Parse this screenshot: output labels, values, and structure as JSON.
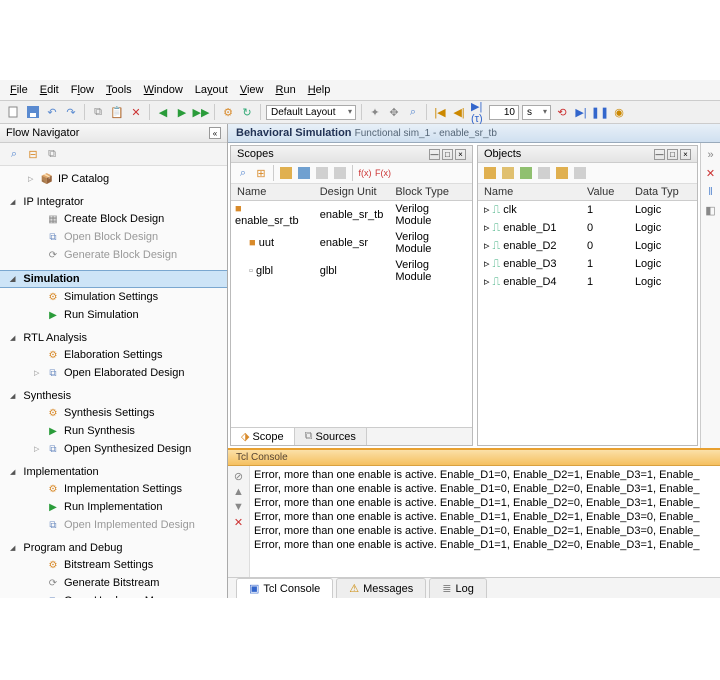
{
  "menu": [
    "File",
    "Edit",
    "Flow",
    "Tools",
    "Window",
    "Layout",
    "View",
    "Run",
    "Help"
  ],
  "toolbar": {
    "layout_combo": "Default Layout",
    "time_value": "10",
    "time_unit": "s"
  },
  "nav": {
    "title": "Flow Navigator",
    "items_top": [
      {
        "label": "Create Block Design",
        "icon": "block"
      },
      {
        "label": "Open Block Design",
        "icon": "open",
        "dim": true
      },
      {
        "label": "Generate Block Design",
        "icon": "gen",
        "dim": true
      }
    ],
    "ip_catalog": "IP Catalog",
    "ip_integrator": "IP Integrator",
    "sim_group": "Simulation",
    "sim_items": [
      {
        "label": "Simulation Settings",
        "icon": "gear"
      },
      {
        "label": "Run Simulation",
        "icon": "run"
      }
    ],
    "rtl_group": "RTL Analysis",
    "rtl_items": [
      {
        "label": "Elaboration Settings",
        "icon": "gear"
      },
      {
        "label": "Open Elaborated Design",
        "icon": "open",
        "expand": true
      }
    ],
    "syn_group": "Synthesis",
    "syn_items": [
      {
        "label": "Synthesis Settings",
        "icon": "gear"
      },
      {
        "label": "Run Synthesis",
        "icon": "run"
      },
      {
        "label": "Open Synthesized Design",
        "icon": "open",
        "expand": true
      }
    ],
    "impl_group": "Implementation",
    "impl_items": [
      {
        "label": "Implementation Settings",
        "icon": "gear"
      },
      {
        "label": "Run Implementation",
        "icon": "run"
      },
      {
        "label": "Open Implemented Design",
        "icon": "open",
        "dim": true
      }
    ],
    "prog_group": "Program and Debug",
    "prog_items": [
      {
        "label": "Bitstream Settings",
        "icon": "gear"
      },
      {
        "label": "Generate Bitstream",
        "icon": "gen"
      },
      {
        "label": "Open Hardware Manager",
        "icon": "open",
        "expand": true
      }
    ]
  },
  "sim_header": {
    "bold": "Behavioral Simulation",
    "rest": "Functional  sim_1 - enable_sr_tb"
  },
  "scopes": {
    "title": "Scopes",
    "cols": [
      "Name",
      "Design Unit",
      "Block Type"
    ],
    "rows": [
      {
        "name": "enable_sr_tb",
        "du": "enable_sr_tb",
        "bt": "Verilog Module",
        "icon": "■",
        "color": "#d88a2a",
        "indent": 0
      },
      {
        "name": "uut",
        "du": "enable_sr",
        "bt": "Verilog Module",
        "icon": "■",
        "color": "#d88a2a",
        "indent": 1
      },
      {
        "name": "glbl",
        "du": "glbl",
        "bt": "Verilog Module",
        "icon": "▫",
        "color": "#888",
        "indent": 1
      }
    ],
    "tabs": [
      "Scope",
      "Sources"
    ]
  },
  "objects": {
    "title": "Objects",
    "cols": [
      "Name",
      "Value",
      "Data Typ"
    ],
    "rows": [
      {
        "name": "clk",
        "val": "1",
        "dt": "Logic"
      },
      {
        "name": "enable_D1",
        "val": "0",
        "dt": "Logic"
      },
      {
        "name": "enable_D2",
        "val": "0",
        "dt": "Logic"
      },
      {
        "name": "enable_D3",
        "val": "1",
        "dt": "Logic"
      },
      {
        "name": "enable_D4",
        "val": "1",
        "dt": "Logic"
      }
    ]
  },
  "console": {
    "title": "Tcl Console",
    "lines": [
      "Error, more than one enable is active. Enable_D1=0, Enable_D2=1, Enable_D3=1, Enable_",
      "Error, more than one enable is active. Enable_D1=0, Enable_D2=0, Enable_D3=1, Enable_",
      "Error, more than one enable is active. Enable_D1=1, Enable_D2=0, Enable_D3=1, Enable_",
      "Error, more than one enable is active. Enable_D1=1, Enable_D2=1, Enable_D3=0, Enable_",
      "Error, more than one enable is active. Enable_D1=0, Enable_D2=1, Enable_D3=0, Enable_",
      "Error, more than one enable is active. Enable_D1=1, Enable_D2=0, Enable_D3=1, Enable_"
    ]
  },
  "bottom_tabs": [
    "Tcl Console",
    "Messages",
    "Log"
  ]
}
